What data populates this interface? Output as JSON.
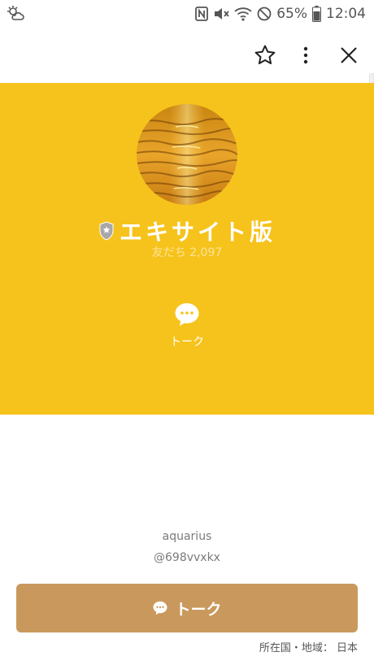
{
  "status_bar": {
    "battery_percent": "65%",
    "time": "12:04"
  },
  "profile": {
    "name": "エキサイト版",
    "friends_label": "友だち 2,097",
    "talk_label": "トーク",
    "id_text": "aquarius",
    "handle": "@698vvxkx"
  },
  "footer": {
    "talk_button_label": "トーク",
    "region_label": "所在国・地域： 日本"
  },
  "colors": {
    "cover": "#f6c31c",
    "talk_button": "#c9985c",
    "scroll_indicator": "#f1f1f1"
  },
  "icons": [
    "weather-icon",
    "nfc-icon",
    "mute-icon",
    "wifi-icon",
    "dnd-icon",
    "battery-icon",
    "star-icon",
    "more-vert-icon",
    "close-icon",
    "official-shield-icon",
    "chat-bubble-icon"
  ]
}
